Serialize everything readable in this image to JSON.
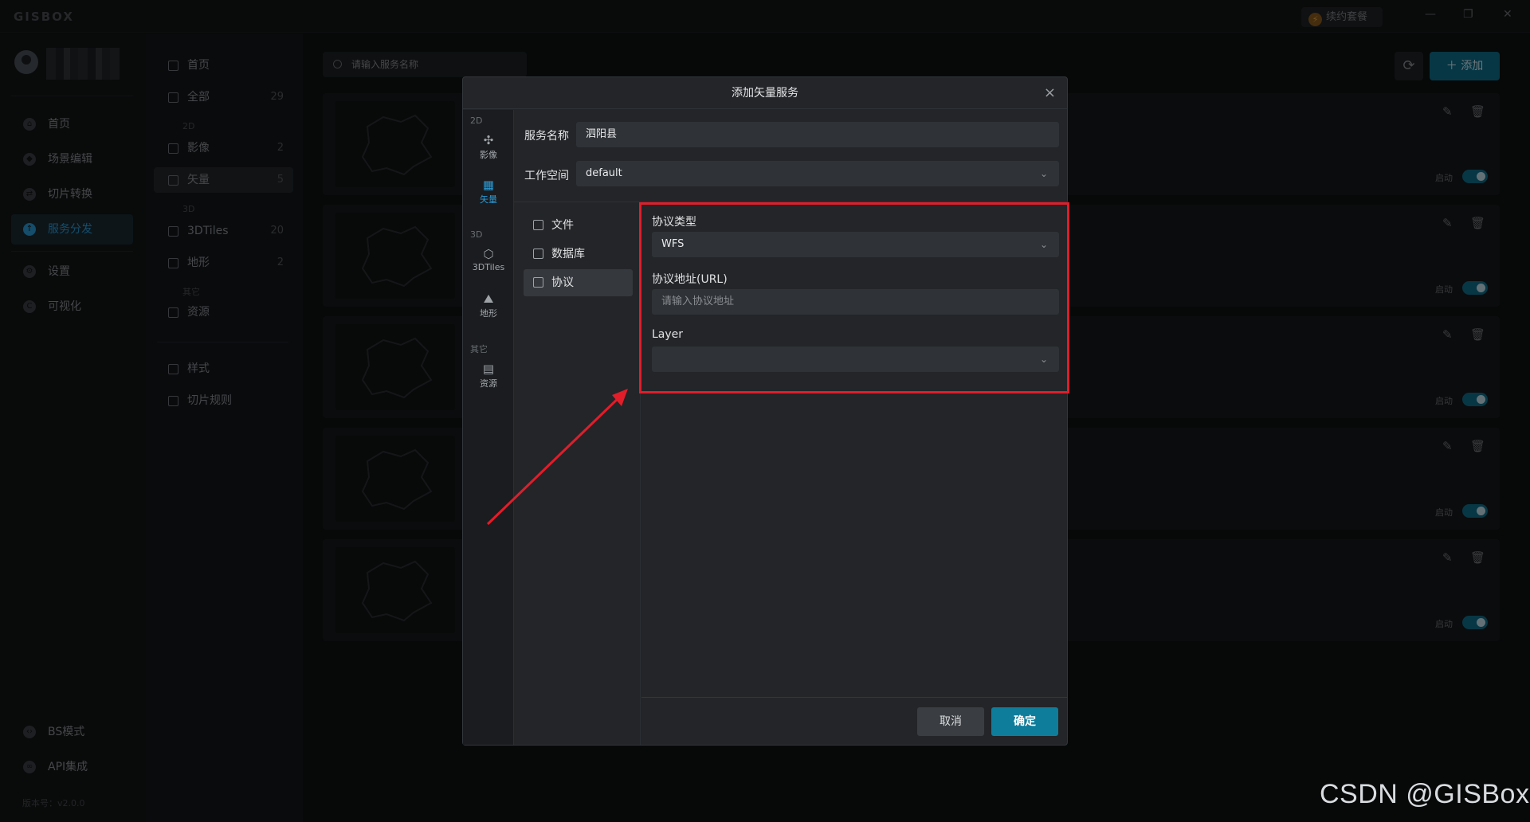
{
  "titlebar": {
    "logo": "GISBOX",
    "renew_label": "续约套餐",
    "minimize": "—",
    "restore": "❐",
    "close": "✕"
  },
  "left_nav": {
    "items": [
      {
        "label": "首页",
        "icon": "home-icon"
      },
      {
        "label": "场景编辑",
        "icon": "cube-icon"
      },
      {
        "label": "切片转换",
        "icon": "swap-icon"
      },
      {
        "label": "服务分发",
        "icon": "upload-icon",
        "active": true
      },
      {
        "label": "设置",
        "icon": "gear-icon"
      },
      {
        "label": "可视化",
        "icon": "chart-icon"
      }
    ],
    "bottom": [
      {
        "label": "BS模式",
        "icon": "code-icon"
      },
      {
        "label": "API集成",
        "icon": "link-icon"
      }
    ],
    "version": "版本号：v2.0.0"
  },
  "category": {
    "home": "首页",
    "all": {
      "label": "全部",
      "count": "29"
    },
    "group_2d": "2D",
    "imagery": {
      "label": "影像",
      "count": "2"
    },
    "vector": {
      "label": "矢量",
      "count": "5"
    },
    "group_3d": "3D",
    "tiles3d": {
      "label": "3DTiles",
      "count": "20"
    },
    "terrain": {
      "label": "地形",
      "count": "2"
    },
    "group_other": "其它",
    "resource": {
      "label": "资源"
    },
    "style": "样式",
    "tile_rules": "切片规则"
  },
  "main": {
    "search_placeholder": "请输入服务名称",
    "add_label": "添加",
    "card_toggle_label": "启动"
  },
  "modal": {
    "title": "添加矢量服务",
    "close": "×",
    "rail": {
      "group_2d": "2D",
      "imagery": "影像",
      "vector": "矢量",
      "group_3d": "3D",
      "tiles3d": "3DTiles",
      "terrain": "地形",
      "group_other": "其它",
      "resource": "资源"
    },
    "service_name_label": "服务名称",
    "service_name_value": "泗阳县",
    "workspace_label": "工作空间",
    "workspace_value": "default",
    "sources": [
      "文件",
      "数据库",
      "协议"
    ],
    "protocol_type_label": "协议类型",
    "protocol_type_value": "WFS",
    "protocol_url_label": "协议地址(URL)",
    "protocol_url_placeholder": "请输入协议地址",
    "layer_label": "Layer",
    "layer_value": "",
    "cancel": "取消",
    "ok": "确定"
  },
  "watermark": "CSDN @GISBox",
  "colors": {
    "accent": "#0e7d9b",
    "active_text": "#2a9bd6",
    "highlight": "#e11d2a"
  }
}
